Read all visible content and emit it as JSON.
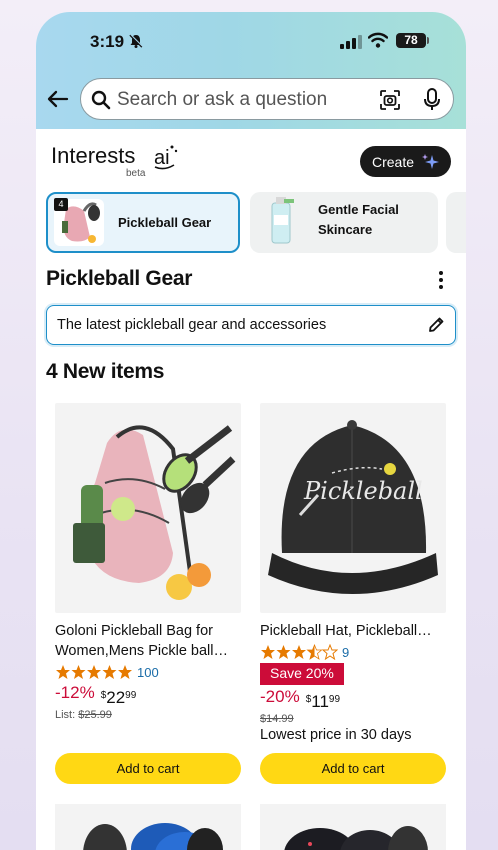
{
  "status_bar": {
    "time": "3:19",
    "battery": "78"
  },
  "search": {
    "placeholder": "Search or ask a question"
  },
  "interests": {
    "title": "Interests",
    "ai": "ai",
    "beta": "beta",
    "create_label": "Create"
  },
  "chips": [
    {
      "label": "Pickleball Gear",
      "badge": "4"
    },
    {
      "label": "Gentle Facial Skincare"
    }
  ],
  "section": {
    "title": "Pickleball Gear",
    "description": "The latest pickleball gear and accessories",
    "items_title": "4 New items"
  },
  "products": [
    {
      "name": "Goloni Pickleball Bag for Women,Mens Pickle ball…",
      "rating": 5,
      "review_count": "100",
      "discount": "-12%",
      "price_symbol": "$",
      "price_whole": "22",
      "price_fraction": "99",
      "list_label": "List:",
      "list_price": "$25.99",
      "add_to_cart": "Add to cart"
    },
    {
      "name": "Pickleball Hat, Pickleball…",
      "rating": 4.5,
      "review_count": "9",
      "save_badge": "Save 20%",
      "discount": "-20%",
      "price_symbol": "$",
      "price_whole": "11",
      "price_fraction": "99",
      "list_price": "$14.99",
      "lowest_note": "Lowest price in 30 days",
      "add_to_cart": "Add to cart"
    }
  ],
  "colors": {
    "accent_blue": "#1e8fc9",
    "cart_yellow": "#ffd814",
    "deal_red": "#cc0c39",
    "star_orange": "#e67a00"
  },
  "icons": [
    "bell-off-icon",
    "signal-icon",
    "wifi-icon",
    "back-arrow-icon",
    "search-icon",
    "camera-icon",
    "microphone-icon",
    "sparkle-icon",
    "kebab-icon",
    "pencil-icon",
    "star-icon"
  ]
}
